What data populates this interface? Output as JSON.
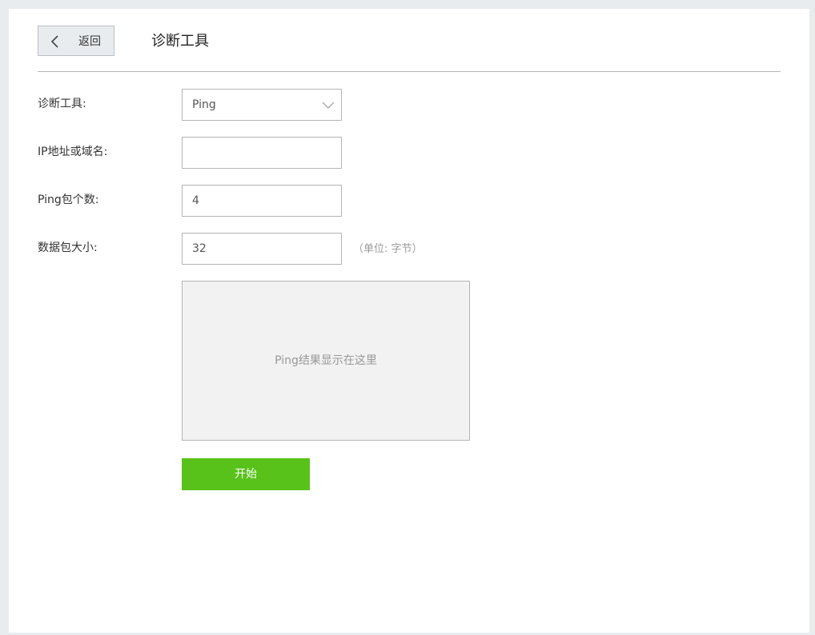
{
  "header": {
    "back_label": "返回",
    "title": "诊断工具"
  },
  "form": {
    "tool": {
      "label": "诊断工具:",
      "selected": "Ping"
    },
    "host": {
      "label": "IP地址或域名:",
      "value": ""
    },
    "count": {
      "label": "Ping包个数:",
      "value": "4"
    },
    "size": {
      "label": "数据包大小:",
      "value": "32",
      "unit": "（单位: 字节）"
    }
  },
  "result": {
    "placeholder": "Ping结果显示在这里"
  },
  "actions": {
    "start_label": "开始"
  },
  "colors": {
    "accent": "#58c21a",
    "page_bg": "#e9ecef",
    "border": "#b5b5b5"
  }
}
